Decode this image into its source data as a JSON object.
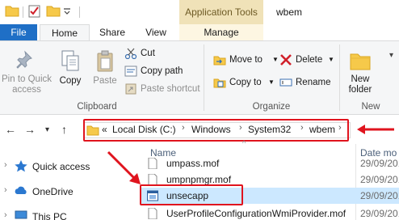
{
  "titlebar": {
    "context_tab": "Application Tools",
    "window_title": "wbem",
    "icons": [
      "folder-icon",
      "properties-icon",
      "new-folder-icon",
      "customize-dropdown-icon"
    ]
  },
  "tabs": {
    "file": "File",
    "home": "Home",
    "share": "Share",
    "view": "View",
    "manage": "Manage"
  },
  "ribbon": {
    "clipboard": {
      "label": "Clipboard",
      "pin": "Pin to Quick access",
      "copy": "Copy",
      "paste": "Paste",
      "cut": "Cut",
      "copy_path": "Copy path",
      "paste_shortcut": "Paste shortcut"
    },
    "organize": {
      "label": "Organize",
      "move_to": "Move to",
      "copy_to": "Copy to",
      "delete": "Delete",
      "rename": "Rename"
    },
    "new": {
      "label": "New",
      "new_folder": "New folder"
    }
  },
  "address": {
    "overflow": "«",
    "crumbs": [
      "Local Disk (C:)",
      "Windows",
      "System32",
      "wbem"
    ]
  },
  "navpane": {
    "items": [
      {
        "label": "Quick access",
        "icon": "star-icon"
      },
      {
        "label": "OneDrive",
        "icon": "cloud-icon"
      },
      {
        "label": "This PC",
        "icon": "computer-icon"
      }
    ]
  },
  "filelist": {
    "columns": {
      "name": "Name",
      "date": "Date mo"
    },
    "rows": [
      {
        "name": "umpass.mof",
        "date": "29/09/201"
      },
      {
        "name": "umpnpmgr.mof",
        "date": "29/09/201"
      },
      {
        "name": "unsecapp",
        "date": "29/09/201",
        "selected": true
      },
      {
        "name": "UserProfileConfigurationWmiProvider.mof",
        "date": "29/09/201"
      }
    ]
  },
  "colors": {
    "accent": "#1f6fc6",
    "highlight": "#e0141e",
    "selection": "#cce8ff",
    "context_tab": "#f0e2b8"
  }
}
